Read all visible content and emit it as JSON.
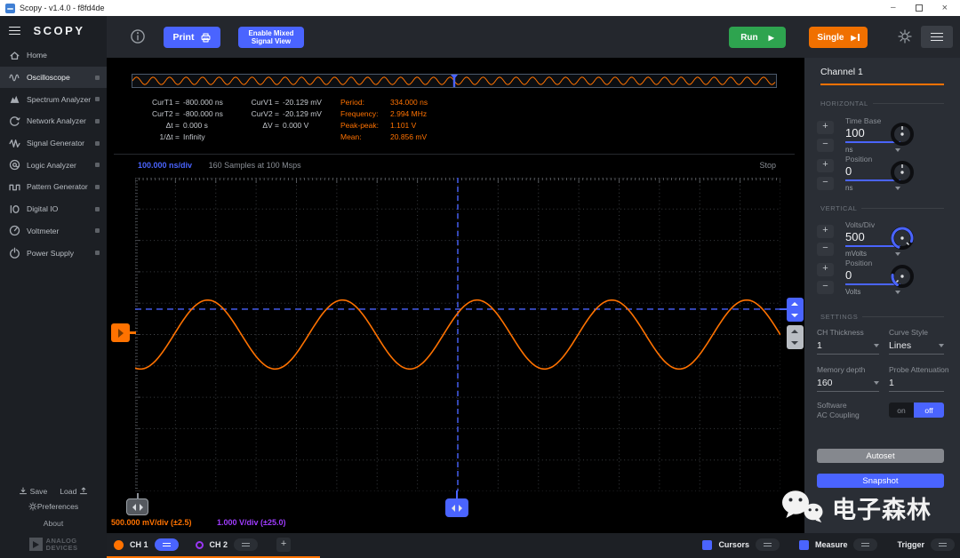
{
  "titlebar": {
    "title": "Scopy - v1.4.0 - f8fd4de",
    "minimize": "–",
    "close": "×"
  },
  "sidebar": {
    "logo": "SCOPY",
    "items": [
      {
        "label": "Home",
        "icon": "home-icon",
        "active": false,
        "indicator": false
      },
      {
        "label": "Oscilloscope",
        "icon": "oscilloscope-icon",
        "active": true,
        "indicator": true
      },
      {
        "label": "Spectrum Analyzer",
        "icon": "spectrum-icon",
        "active": false,
        "indicator": true
      },
      {
        "label": "Network Analyzer",
        "icon": "network-icon",
        "active": false,
        "indicator": true
      },
      {
        "label": "Signal Generator",
        "icon": "signal-generator-icon",
        "active": false,
        "indicator": true
      },
      {
        "label": "Logic Analyzer",
        "icon": "logic-analyzer-icon",
        "active": false,
        "indicator": true
      },
      {
        "label": "Pattern Generator",
        "icon": "pattern-generator-icon",
        "active": false,
        "indicator": true
      },
      {
        "label": "Digital IO",
        "icon": "digital-io-icon",
        "active": false,
        "indicator": true
      },
      {
        "label": "Voltmeter",
        "icon": "voltmeter-icon",
        "active": false,
        "indicator": true
      },
      {
        "label": "Power Supply",
        "icon": "power-supply-icon",
        "active": false,
        "indicator": true
      }
    ],
    "footer": {
      "save": "Save",
      "load": "Load",
      "preferences": "Preferences",
      "about": "About",
      "brand_top": "ANALOG",
      "brand_bottom": "DEVICES"
    }
  },
  "toolbar": {
    "print": "Print",
    "mixed_line1": "Enable Mixed",
    "mixed_line2": "Signal View",
    "run": "Run",
    "single": "Single"
  },
  "scope": {
    "cursors_time": [
      {
        "l": "CurT1 =",
        "v": "-800.000 ns"
      },
      {
        "l": "CurT2 =",
        "v": "-800.000 ns"
      },
      {
        "l": "Δt =",
        "v": "0.000 s"
      },
      {
        "l": "1/Δt =",
        "v": "Infinity"
      }
    ],
    "cursors_volt": [
      {
        "l": "CurV1 =",
        "v": "-20.129 mV"
      },
      {
        "l": "CurV2 =",
        "v": "-20.129 mV"
      },
      {
        "l": "ΔV =",
        "v": "0.000 V"
      }
    ],
    "stats": [
      {
        "l": "Period:",
        "v": "334.000 ns"
      },
      {
        "l": "Frequency:",
        "v": "2.994 MHz"
      },
      {
        "l": "Peak-peak:",
        "v": "1.101 V"
      },
      {
        "l": "Mean:",
        "v": "20.856 mV"
      }
    ],
    "header": {
      "timebase": "100.000 ns/div",
      "samples": "160 Samples at 100 Msps",
      "state": "Stop"
    },
    "axis_ch1": "500.000 mV/div (±2.5)",
    "axis_ch2": "1.000 V/div (±25.0)"
  },
  "chart_data": {
    "type": "line",
    "title": "Oscilloscope CH1 capture",
    "signal": "sine",
    "period_ns": 334,
    "frequency_mhz": 2.994,
    "peak_peak_v": 1.101,
    "mean_mv": 20.856,
    "timebase_ns_per_div": 100,
    "hdivisions": 16,
    "volts_per_div_mv": 500,
    "vdivisions": 10,
    "samples": 160,
    "sample_rate_msps": 100,
    "x_range_ns": [
      -800,
      800
    ],
    "y_range_v": [
      -2.5,
      2.5
    ],
    "amplitude_div": 1.1,
    "peak_offset_div": 0.48,
    "trigger_level_div": 0.81,
    "trigger_position_div": 0,
    "overview_cycles": 39,
    "series": [
      {
        "name": "CH1",
        "color": "#ff7200"
      }
    ]
  },
  "right_panel": {
    "title": "Channel 1",
    "plus": "+",
    "minus": "−",
    "horizontal": {
      "heading": "HORIZONTAL",
      "timebase": {
        "label": "Time Base",
        "value": "100",
        "unit": "ns"
      },
      "position": {
        "label": "Position",
        "value": "0",
        "unit": "ns"
      }
    },
    "vertical": {
      "heading": "VERTICAL",
      "voltsdiv": {
        "label": "Volts/Div",
        "value": "500",
        "unit": "mVolts"
      },
      "position": {
        "label": "Position",
        "value": "0",
        "unit": "Volts"
      }
    },
    "settings": {
      "heading": "SETTINGS",
      "ch_thickness_label": "CH Thickness",
      "ch_thickness": "1",
      "curve_style_label": "Curve Style",
      "curve_style": "Lines",
      "memory_depth_label": "Memory depth",
      "memory_depth": "160",
      "probe_label": "Probe Attenuation",
      "probe": "1",
      "ac_label_line1": "Software",
      "ac_label_line2": "AC Coupling",
      "ac_on": "on",
      "ac_off": "off"
    },
    "autoset": "Autoset",
    "snapshot": "Snapshot"
  },
  "bottombar": {
    "ch1": "CH 1",
    "ch2": "CH 2",
    "add": "+",
    "cursors": "Cursors",
    "measure": "Measure",
    "trigger": "Trigger"
  },
  "watermark": "电子森林",
  "colors": {
    "accent_blue": "#4a64ff",
    "ch1_orange": "#ff7200",
    "run_green": "#2ea44f",
    "ch2_purple": "#9a36f5",
    "single_orange": "#f07000"
  }
}
